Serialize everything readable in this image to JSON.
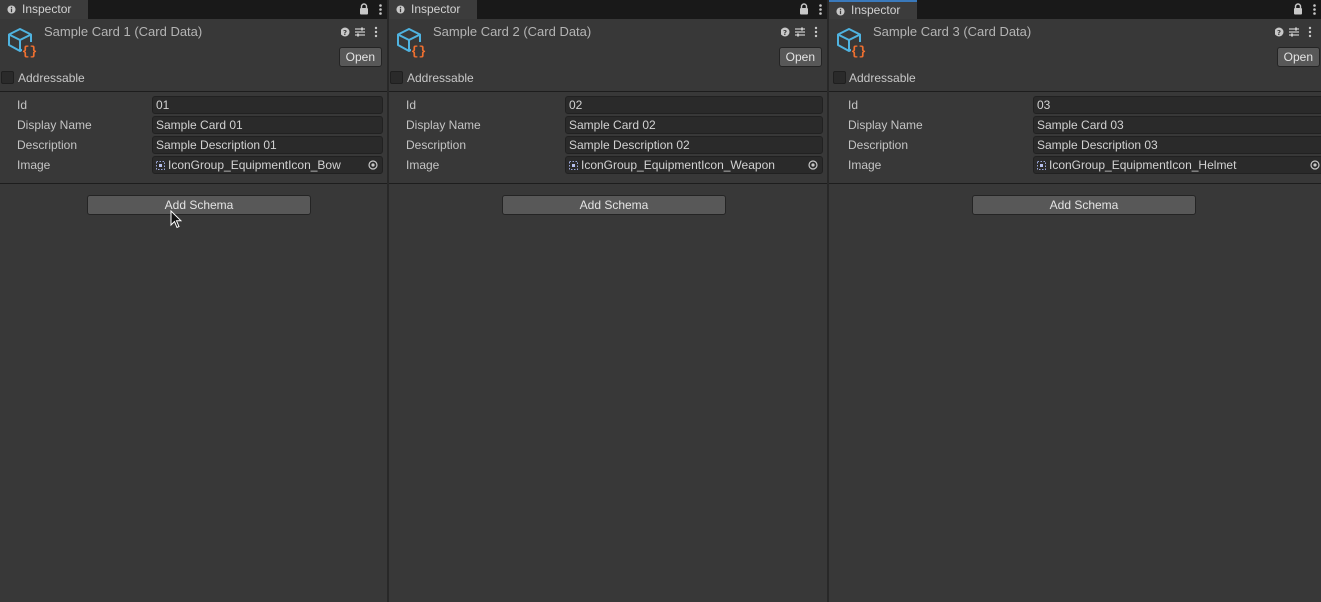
{
  "tab_label": "Inspector",
  "open_label": "Open",
  "addressable_label": "Addressable",
  "add_schema_label": "Add Schema",
  "field_labels": {
    "id": "Id",
    "display_name": "Display Name",
    "description": "Description",
    "image": "Image"
  },
  "icons": [
    "info-icon",
    "lock-icon",
    "kebab-menu-icon",
    "help-icon",
    "preset-icon",
    "card-data-asset-icon",
    "sprite-icon",
    "object-picker-icon",
    "mouse-cursor-icon"
  ],
  "colors": {
    "panel_bg": "#383838",
    "field_bg": "#2a2a2a",
    "button_bg": "#585858",
    "active_tab_accent": "#3a79bb",
    "asset_icon_blue": "#4fb3e0",
    "asset_icon_orange": "#f07030"
  },
  "panels": [
    {
      "title": "Sample Card 1 (Card Data)",
      "addressable": false,
      "id": "01",
      "display_name": "Sample Card 01",
      "description": "Sample Description 01",
      "image": "IconGroup_EquipmentIcon_Bow"
    },
    {
      "title": "Sample Card 2 (Card Data)",
      "addressable": false,
      "id": "02",
      "display_name": "Sample Card 02",
      "description": "Sample Description 02",
      "image": "IconGroup_EquipmentIcon_Weapon"
    },
    {
      "title": "Sample Card 3 (Card Data)",
      "addressable": false,
      "active_tab": true,
      "id": "03",
      "display_name": "Sample Card 03",
      "description": "Sample Description 03",
      "image": "IconGroup_EquipmentIcon_Helmet"
    }
  ]
}
